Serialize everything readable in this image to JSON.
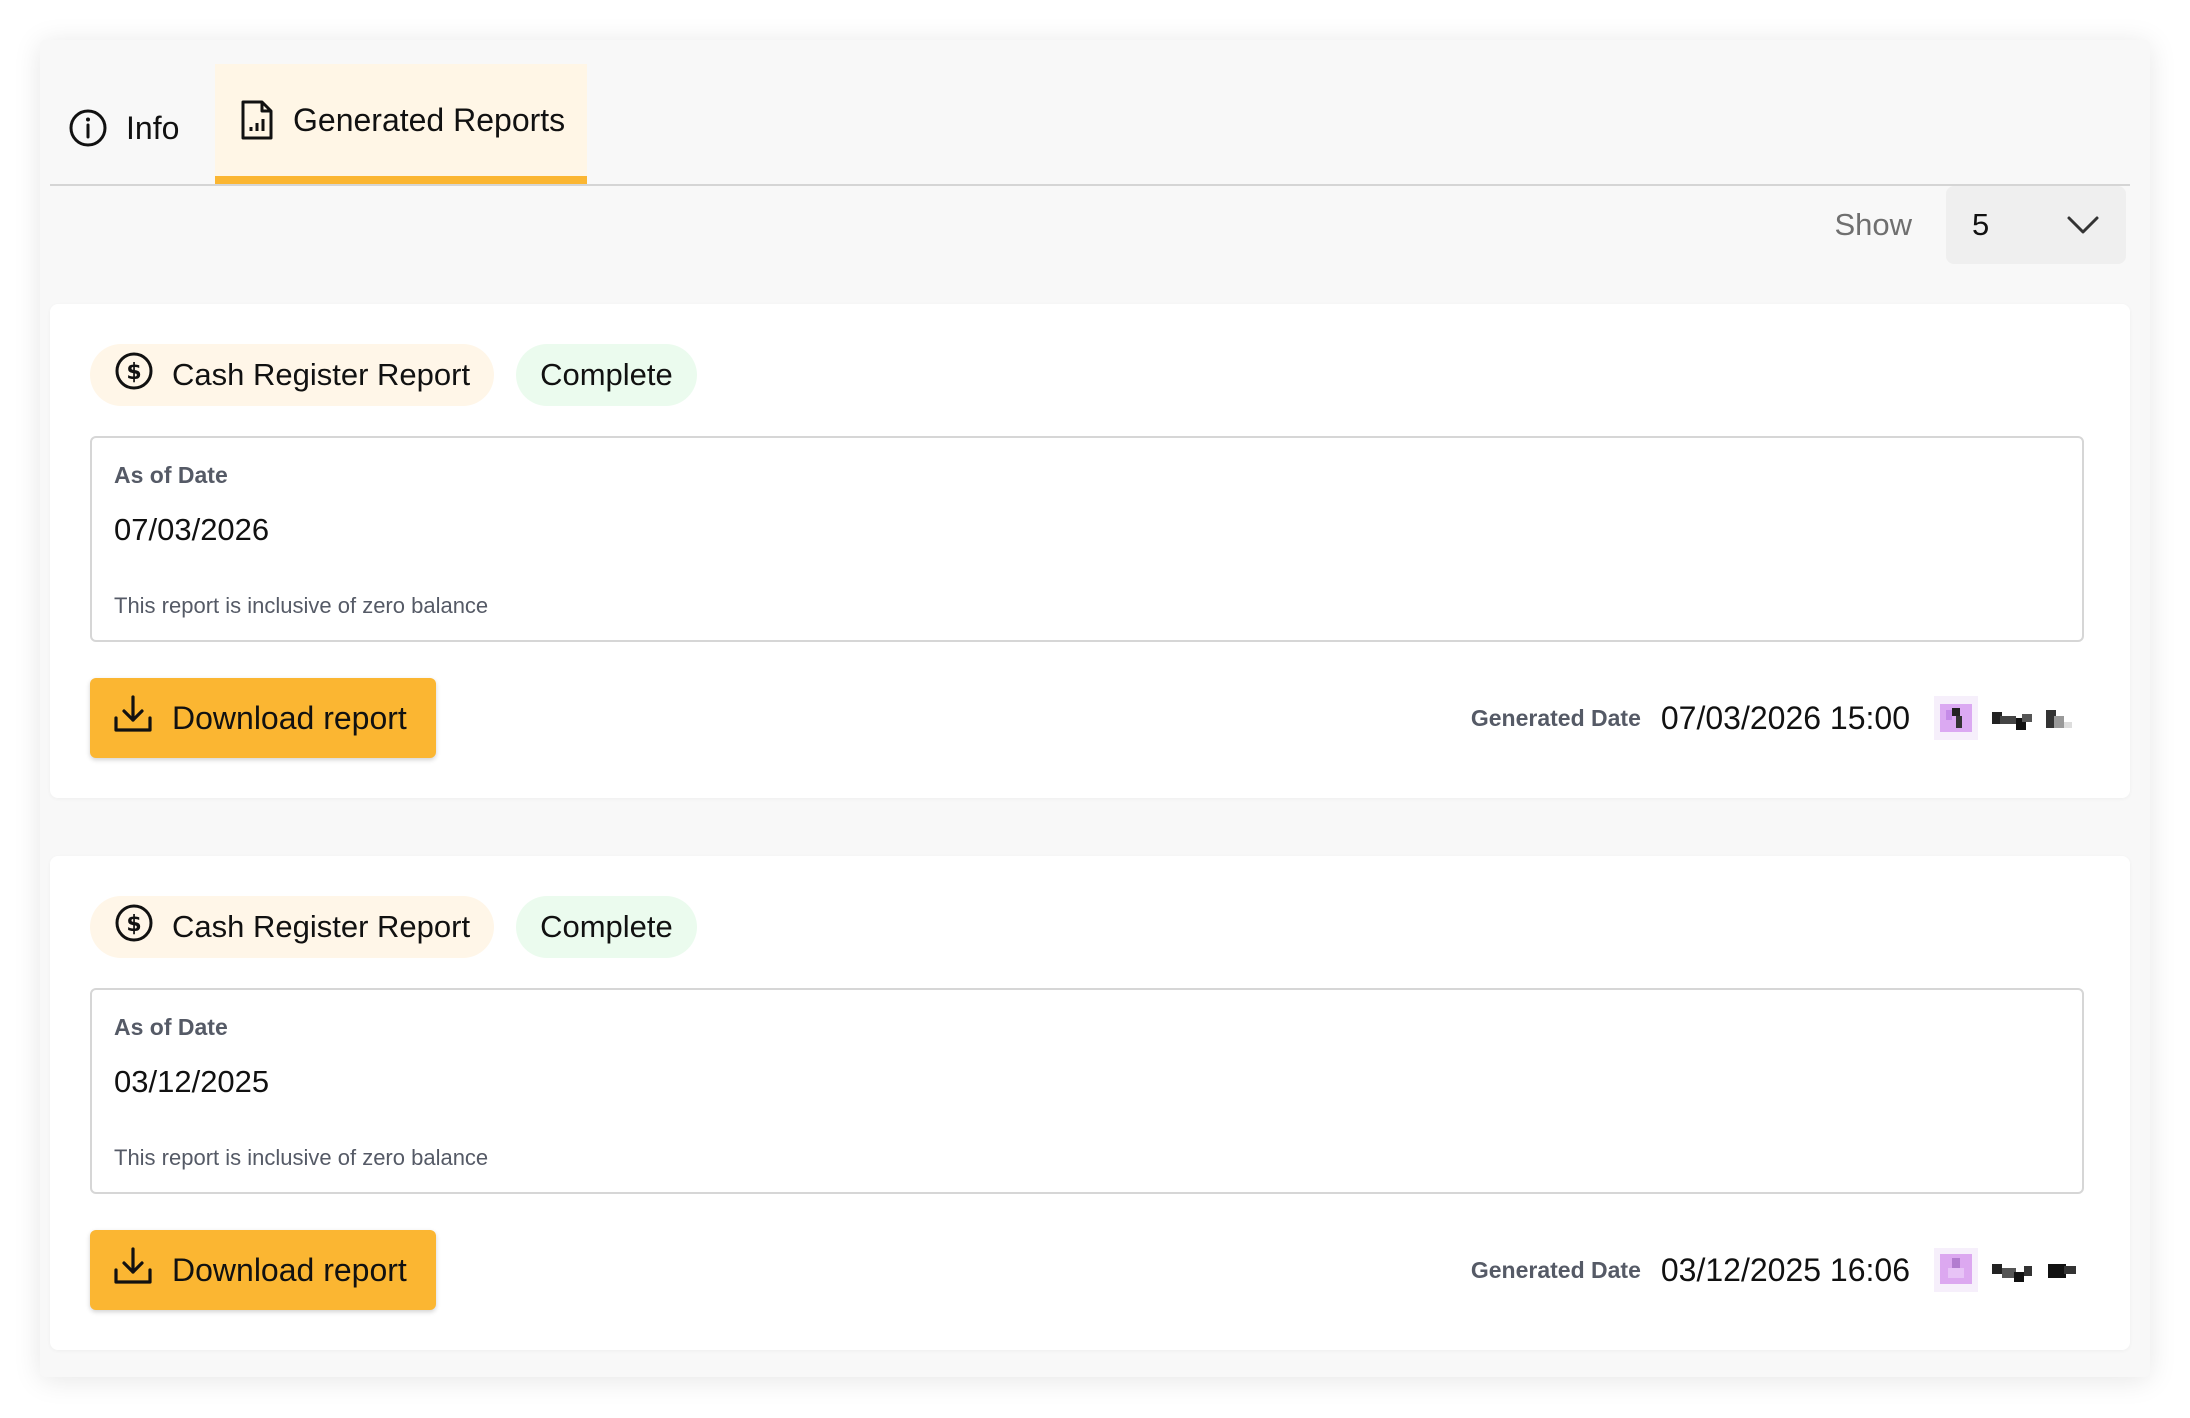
{
  "tabs": [
    {
      "label": "Info",
      "icon": "info-circle-icon",
      "active": false
    },
    {
      "label": "Generated Reports",
      "icon": "report-document-icon",
      "active": true
    }
  ],
  "show": {
    "label": "Show",
    "value": "5"
  },
  "colors": {
    "accent": "#fbb632",
    "accent_tint": "#fff6e6",
    "status_complete_bg": "#ebfbee"
  },
  "reports": [
    {
      "type_label": "Cash Register Report",
      "type_icon": "dollar-circle-icon",
      "status": "Complete",
      "as_of_label": "As of Date",
      "as_of_date": "07/03/2026",
      "note": "This report is inclusive of zero balance",
      "download_label": "Download report",
      "generated_label": "Generated Date",
      "generated_date": "07/03/2026 15:00"
    },
    {
      "type_label": "Cash Register Report",
      "type_icon": "dollar-circle-icon",
      "status": "Complete",
      "as_of_label": "As of Date",
      "as_of_date": "03/12/2025",
      "note": "This report is inclusive of zero balance",
      "download_label": "Download report",
      "generated_label": "Generated Date",
      "generated_date": "03/12/2025 16:06"
    }
  ]
}
